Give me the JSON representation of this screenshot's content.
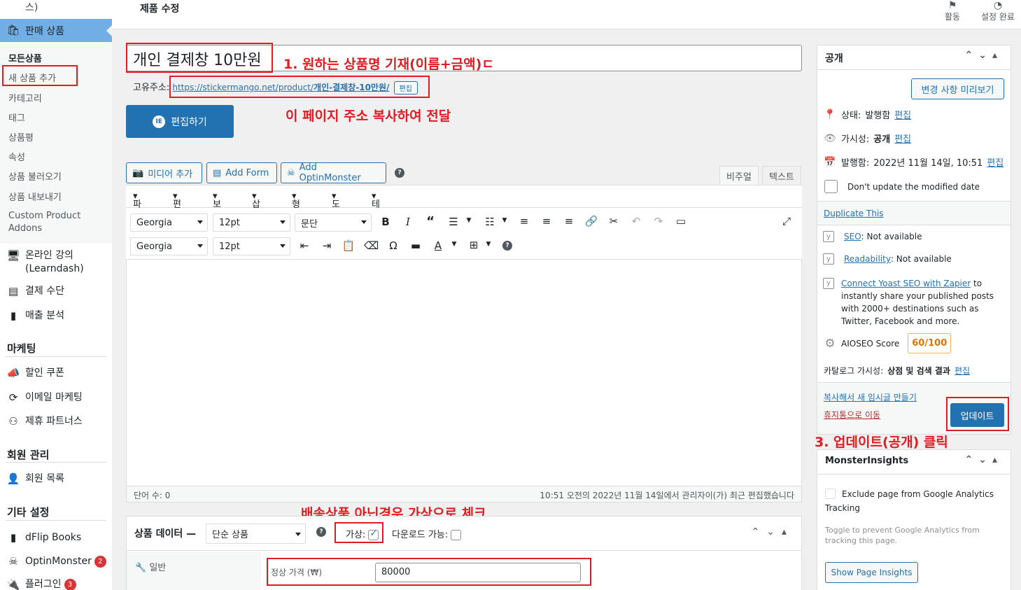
{
  "sidebar": {
    "top_partial": "스)",
    "active_menu": "판매 상품",
    "submenu": [
      "모든상품",
      "새 상품 추가",
      "카테고리",
      "태그",
      "상품평",
      "속성",
      "상품 불러오기",
      "상품 내보내기",
      "Custom Product Addons"
    ],
    "menu1": [
      {
        "label": "온라인 강의 (Learndash)",
        "icon": "monitor-icon"
      },
      {
        "label": "결제 수단",
        "icon": "credit-card-icon"
      },
      {
        "label": "매출 분석",
        "icon": "bar-chart-icon"
      }
    ],
    "section_marketing": "마케팅",
    "marketing": [
      {
        "label": "할인 쿠폰",
        "icon": "megaphone-icon"
      },
      {
        "label": "이메일 마케팅",
        "icon": "refresh-icon"
      },
      {
        "label": "제휴 파트너스",
        "icon": "network-icon"
      }
    ],
    "section_members": "회원 관리",
    "members": [
      {
        "label": "회원 목록",
        "icon": "user-icon"
      }
    ],
    "section_other": "기타 설정",
    "other": [
      {
        "label": "dFlip Books",
        "icon": "book-icon",
        "badge": ""
      },
      {
        "label": "OptinMonster",
        "icon": "monster-icon",
        "badge": "2"
      },
      {
        "label": "플러그인",
        "icon": "plugin-icon",
        "badge": "3"
      }
    ]
  },
  "topbar": {
    "title": "제품 수정",
    "activity": "활동",
    "setup_done": "설정 완료"
  },
  "title_field": {
    "value": "개인 결제창 10만원"
  },
  "permalink": {
    "label": "고유주소:",
    "url_prefix": "https://stickermango.net/product/",
    "url_slug": "개인-결제창-10만원/",
    "edit": "편집"
  },
  "elementor_button": "편집하기",
  "annotations": {
    "note1": "1. 원하는 상품명 기재(이름+금액)ㄷ",
    "note2": "이 페이지 주소 복사하여 전달",
    "note3": "3. 업데이트(공개) 클릭",
    "note4": "배송상품 아닌경우 가상으로 체크"
  },
  "editor": {
    "media_buttons": [
      "미디어 추가",
      "Add Form",
      "Add OptinMonster"
    ],
    "tabs": [
      "비주얼",
      "텍스트"
    ],
    "menubar": [
      "파일",
      "편집",
      "보기",
      "삽입",
      "형식",
      "도구",
      "테이블"
    ],
    "font_family": "Georgia",
    "font_size": "12pt",
    "format": "문단",
    "word_count": "단어 수: 0",
    "last_edited": "10:51 오전의 2022년 11월 14일에서 관리자이(가) 최근 편집했습니다"
  },
  "product_data": {
    "label": "상품 데이터 —",
    "type": "단순 상품",
    "virtual_label": "가상:",
    "virtual_checked": true,
    "downloadable_label": "다운로드 가능:",
    "downloadable_checked": false,
    "tab_general": "일반",
    "regular_price_label": "정상 가격 (₩)",
    "regular_price": "80000"
  },
  "publish": {
    "title": "공개",
    "preview": "변경 사항 미리보기",
    "status_label": "상태:",
    "status_value": "발행함",
    "visibility_label": "가시성:",
    "visibility_value": "공개",
    "published_label": "발행함:",
    "published_value": "2022년 11월 14일, 10:51",
    "edit": "편집",
    "dont_update": "Don't update the modified date",
    "duplicate": "Duplicate This",
    "seo_link": "SEO",
    "seo_value": ": Not available",
    "readability_link": "Readability",
    "readability_value": ": Not available",
    "zapier_link": "Connect Yoast SEO with Zapier",
    "zapier_text": "to instantly share your published posts with 2000+ destinations such as Twitter, Facebook and more.",
    "aioseo_label": "AIOSEO Score",
    "aioseo_score": "60/100",
    "catalog_label": "카탈로그 가시성:",
    "catalog_value": "상점 및 검색 결과",
    "copy_draft": "복사해서 새 임시글 만들기",
    "trash": "휴지통으로 이동",
    "update": "업데이트"
  },
  "monsterinsights": {
    "title": "MonsterInsights",
    "exclude": "Exclude page from Google Analytics Tracking",
    "toggle_help": "Toggle to prevent Google Analytics from tracking this page.",
    "show_insights": "Show Page Insights"
  },
  "colors": {
    "accent": "#2271b1",
    "annotation": "#e01b22",
    "sidebar_active": "#72aee6"
  }
}
